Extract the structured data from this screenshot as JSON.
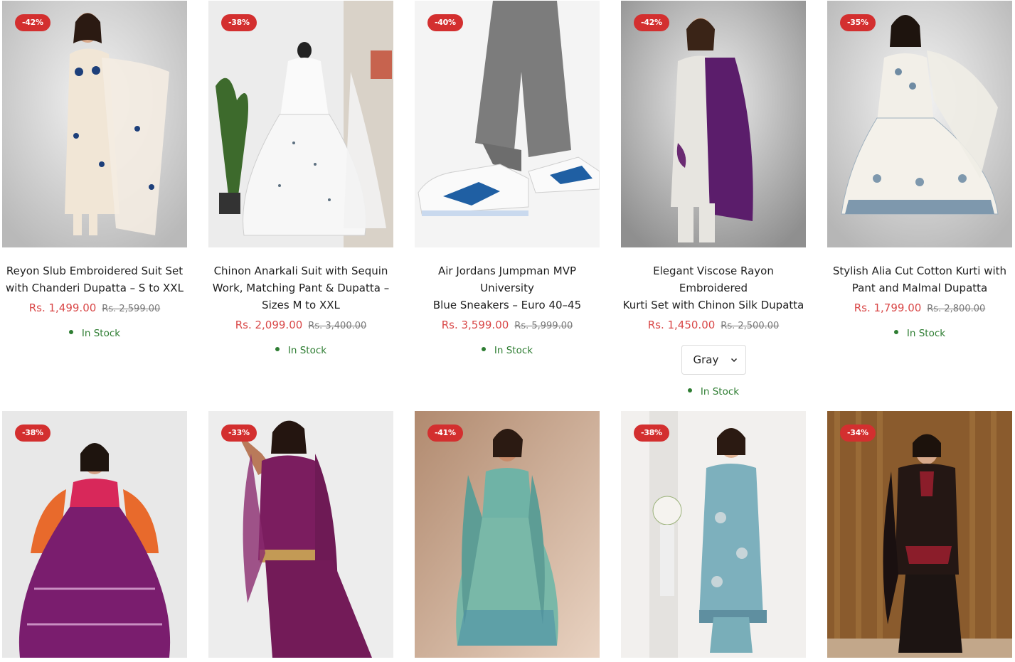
{
  "products": [
    {
      "discount": "-42%",
      "title_lines": [
        "Reyon Slub Embroidered Suit Set",
        "with Chanderi Dupatta – S to XXL"
      ],
      "price": "Rs. 1,499.00",
      "compare_price": "Rs. 2,599.00",
      "stock": "In Stock",
      "image_icon": "woman-in-cream-suit-image"
    },
    {
      "discount": "-38%",
      "title_lines": [
        "Chinon Anarkali Suit with Sequin",
        "Work, Matching Pant & Dupatta –",
        "Sizes M to XXL"
      ],
      "price": "Rs. 2,099.00",
      "compare_price": "Rs. 3,400.00",
      "stock": "In Stock",
      "image_icon": "white-anarkali-on-mannequin-image"
    },
    {
      "discount": "-40%",
      "title_lines": [
        "Air Jordans Jumpman MVP University",
        "Blue Sneakers – Euro 40–45"
      ],
      "price": "Rs. 3,599.00",
      "compare_price": "Rs. 5,999.00",
      "stock": "In Stock",
      "image_icon": "blue-white-sneakers-image"
    },
    {
      "discount": "-42%",
      "title_lines": [
        "Elegant Viscose Rayon Embroidered",
        "Kurti Set with Chinon Silk Dupatta"
      ],
      "price": "Rs. 1,450.00",
      "compare_price": "Rs. 2,500.00",
      "variant": "Gray",
      "stock": "In Stock",
      "image_icon": "woman-white-kurti-purple-dupatta-image"
    },
    {
      "discount": "-35%",
      "title_lines": [
        "Stylish Alia Cut Cotton Kurti with",
        "Pant and Malmal Dupatta"
      ],
      "price": "Rs. 1,799.00",
      "compare_price": "Rs. 2,800.00",
      "stock": "In Stock",
      "image_icon": "woman-printed-alia-kurti-image"
    },
    {
      "discount": "-38%",
      "image_icon": "woman-purple-lehenga-image"
    },
    {
      "discount": "-33%",
      "image_icon": "woman-purple-sharara-suit-image"
    },
    {
      "discount": "-41%",
      "image_icon": "woman-teal-anarkali-image"
    },
    {
      "discount": "-38%",
      "image_icon": "woman-blue-embroidered-suit-image"
    },
    {
      "discount": "-34%",
      "image_icon": "woman-black-kurta-set-image"
    }
  ],
  "colors": {
    "badge": "#d32f2f",
    "sale_price": "#d94848",
    "stock": "#2e7d32"
  }
}
